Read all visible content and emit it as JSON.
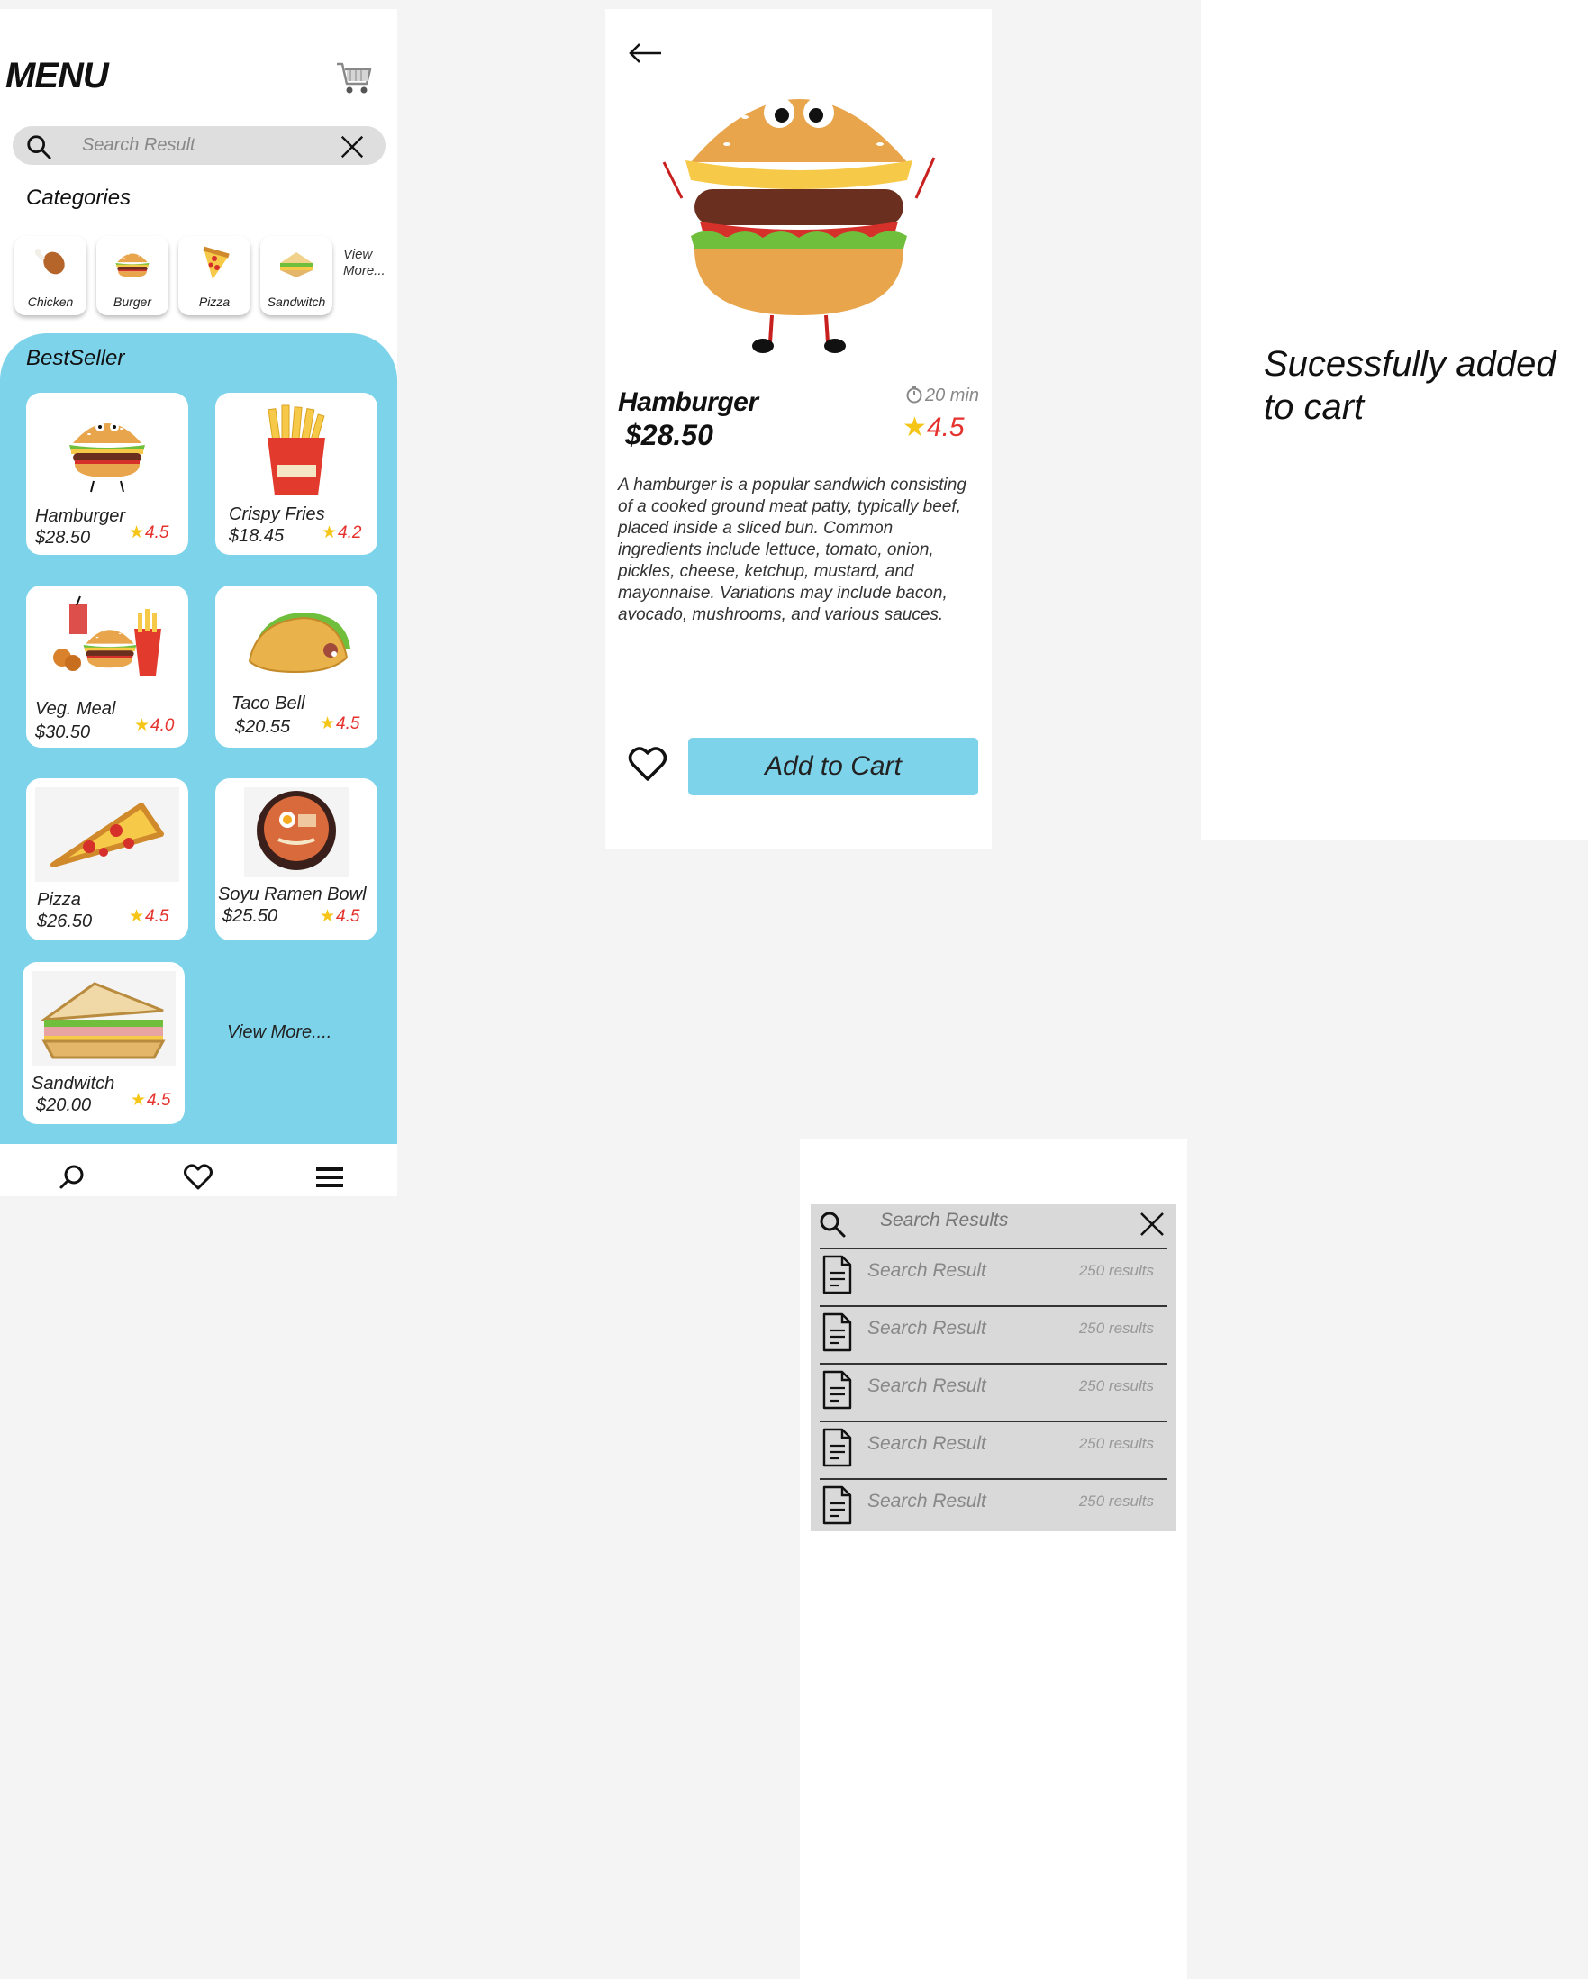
{
  "menu": {
    "title": "MENU",
    "search": {
      "placeholder": "Search Result"
    },
    "categories_title": "Categories",
    "categories": [
      {
        "label": "Chicken",
        "icon": "chicken-leg-icon"
      },
      {
        "label": "Burger",
        "icon": "burger-icon"
      },
      {
        "label": "Pizza",
        "icon": "pizza-slice-icon"
      },
      {
        "label": "Sandwitch",
        "icon": "sandwich-icon"
      }
    ],
    "categories_more": "View More...",
    "bestseller_title": "BestSeller",
    "items": [
      {
        "name": "Hamburger",
        "price": "$28.50",
        "rating": "4.5"
      },
      {
        "name": "Crispy Fries",
        "price": "$18.45",
        "rating": "4.2"
      },
      {
        "name": "Veg. Meal",
        "price": "$30.50",
        "rating": "4.0"
      },
      {
        "name": "Taco Bell",
        "price": "$20.55",
        "rating": "4.5"
      },
      {
        "name": "Pizza",
        "price": "$26.50",
        "rating": "4.5"
      },
      {
        "name": "Soyu Ramen Bowl",
        "price": "$25.50",
        "rating": "4.5"
      },
      {
        "name": "Sandwitch",
        "price": "$20.00",
        "rating": "4.5"
      }
    ],
    "view_more": "View More....",
    "nav": [
      "search-icon",
      "heart-icon",
      "hamburger-menu-icon"
    ]
  },
  "detail": {
    "name": "Hamburger",
    "price": "$28.50",
    "time": "20 min",
    "rating": "4.5",
    "description": "A hamburger is a popular sandwich consisting of a cooked ground meat patty, typically beef, placed inside a sliced bun. Common ingredients include lettuce, tomato, onion, pickles, cheese, ketchup, mustard, and mayonnaise. Variations may include bacon, avocado, mushrooms, and various sauces.",
    "add_to_cart": "Add to Cart"
  },
  "success": {
    "message": "Sucessfully added to cart"
  },
  "results": {
    "search": {
      "placeholder": "Search Results"
    },
    "rows": [
      {
        "label": "Search Result",
        "count": "250 results"
      },
      {
        "label": "Search Result",
        "count": "250 results"
      },
      {
        "label": "Search Result",
        "count": "250 results"
      },
      {
        "label": "Search Result",
        "count": "250 results"
      },
      {
        "label": "Search Result",
        "count": "250 results"
      }
    ]
  },
  "colors": {
    "accent": "#7dd3ea",
    "rating": "#e5322d",
    "star": "#f5c518"
  }
}
